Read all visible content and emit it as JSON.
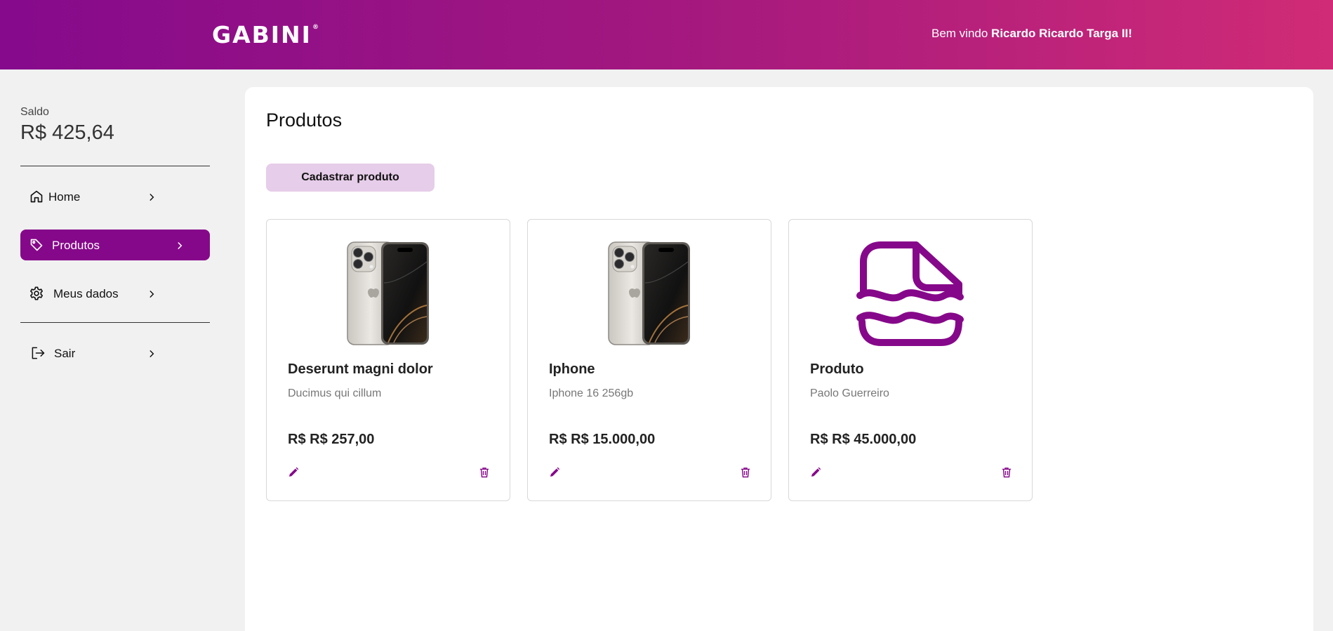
{
  "header": {
    "logo_text": "GABINI",
    "logo_mark": "®",
    "welcome_prefix": "Bem vindo ",
    "user_name": "Ricardo Ricardo Targa II!",
    "gradient_start": "#850a8c",
    "gradient_end": "#d02b76"
  },
  "sidebar": {
    "balance_label": "Saldo",
    "balance_value": "R$ 425,64",
    "items": [
      {
        "label": "Home",
        "icon": "home-icon",
        "active": false
      },
      {
        "label": "Produtos",
        "icon": "tag-icon",
        "active": true
      },
      {
        "label": "Meus dados",
        "icon": "gear-icon",
        "active": false
      },
      {
        "label": "Sair",
        "icon": "logout-icon",
        "active": false
      }
    ],
    "active_color": "#86088a"
  },
  "main": {
    "title": "Produtos",
    "add_button_label": "Cadastrar produto",
    "accent_color": "#86088a",
    "products": [
      {
        "name": "Deserunt magni dolor",
        "description": "Ducimus qui cillum",
        "price": "R$ R$ 257,00",
        "image": "phone-image"
      },
      {
        "name": "Iphone",
        "description": "Iphone 16 256gb",
        "price": "R$ R$ 15.000,00",
        "image": "phone-image"
      },
      {
        "name": "Produto",
        "description": "Paolo Guerreiro",
        "price": "R$ R$ 45.000,00",
        "image": "placeholder-image-icon"
      }
    ]
  }
}
